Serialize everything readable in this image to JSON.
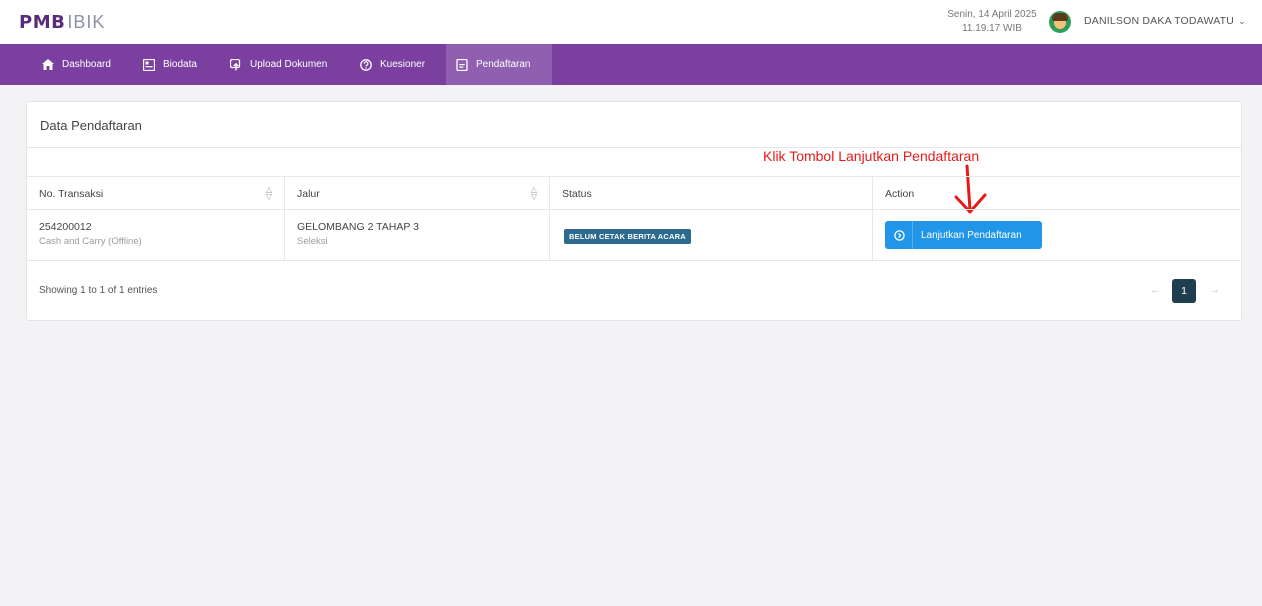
{
  "header": {
    "logo_main": "PMB",
    "logo_sub": "IBIK",
    "date": "Senin, 14 April 2025",
    "time": "11.19.17 WIB",
    "username": "DANILSON DAKA TODAWATU",
    "chevron": "⌄"
  },
  "nav": {
    "items": [
      {
        "label": "Dashboard",
        "icon": "home-icon"
      },
      {
        "label": "Biodata",
        "icon": "id-card-icon"
      },
      {
        "label": "Upload Dokumen",
        "icon": "upload-icon"
      },
      {
        "label": "Kuesioner",
        "icon": "question-icon"
      },
      {
        "label": "Pendaftaran",
        "icon": "document-icon"
      }
    ],
    "active": "Pendaftaran",
    "accent_color": "#7b3fa0"
  },
  "card": {
    "title": "Data Pendaftaran",
    "annotation": "Klik Tombol Lanjutkan Pendaftaran",
    "annotation_color": "#e41b1b"
  },
  "table": {
    "headers": [
      "No. Transaksi",
      "Jalur",
      "Status",
      "Action"
    ],
    "rows": [
      {
        "transaction_no": "254200012",
        "transaction_type": "Cash and Carry (Offline)",
        "jalur": "GELOMBANG 2 TAHAP 3",
        "jalur_sub": "Seleksi",
        "status": "BELUM CETAK BERITA ACARA",
        "action_label": "Lanjutkan Pendaftaran"
      }
    ]
  },
  "footer": {
    "showing": "Showing 1 to 1 of 1 entries",
    "prev": "←",
    "page": "1",
    "next": "→"
  }
}
